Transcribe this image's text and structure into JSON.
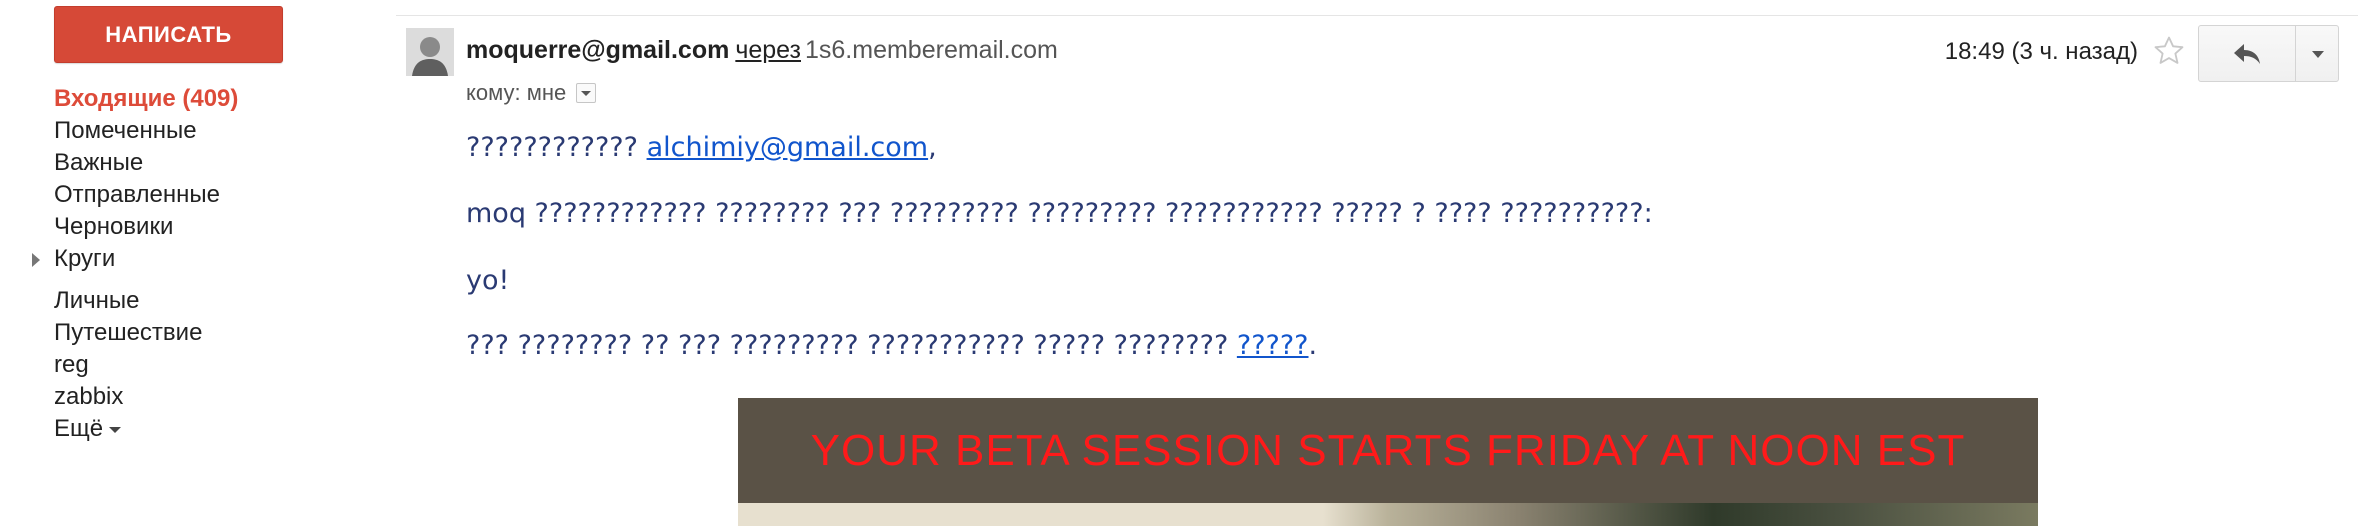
{
  "left_nav": {
    "compose_label": "НАПИСАТЬ",
    "items": [
      {
        "label": "Входящие (409)",
        "active": true
      },
      {
        "label": "Помеченные"
      },
      {
        "label": "Важные"
      },
      {
        "label": "Отправленные"
      },
      {
        "label": "Черновики"
      },
      {
        "label": "Круги",
        "expandable": true
      },
      {
        "label": "Личные"
      },
      {
        "label": "Путешествие"
      },
      {
        "label": "reg"
      },
      {
        "label": "zabbix"
      },
      {
        "label": "Ещё"
      }
    ]
  },
  "message": {
    "sender": "moquerre@gmail.com",
    "via_label": "через",
    "via_domain": "1s6.memberemail.com",
    "to_label": "кому: мне",
    "time": "18:49 (3 ч. назад)",
    "body": {
      "greeting_prefix": "???????????? ",
      "greeting_email": "alchimiy@gmail.com",
      "greeting_suffix": ",",
      "line2": "moq ???????????? ???????? ??? ????????? ????????? ??????????? ????? ? ???? ??????????:",
      "line3": "yo!",
      "line4_prefix": "??? ???????? ?? ??? ????????? ??????????? ????? ???????? ",
      "line4_link": "?????",
      "line4_suffix": "."
    },
    "banner_text": "YOUR BETA SESSION STARTS FRIDAY AT NOON EST"
  },
  "icons": {
    "star": "star-outline-icon",
    "reply": "reply-arrow-icon",
    "more": "chevron-down-icon"
  },
  "colors": {
    "compose": "#d64937",
    "active_nav": "#dd4b39",
    "link": "#1155cc",
    "body_text": "#2a3a73",
    "banner_bg": "#5a5246",
    "banner_text": "#ff1a1a"
  }
}
